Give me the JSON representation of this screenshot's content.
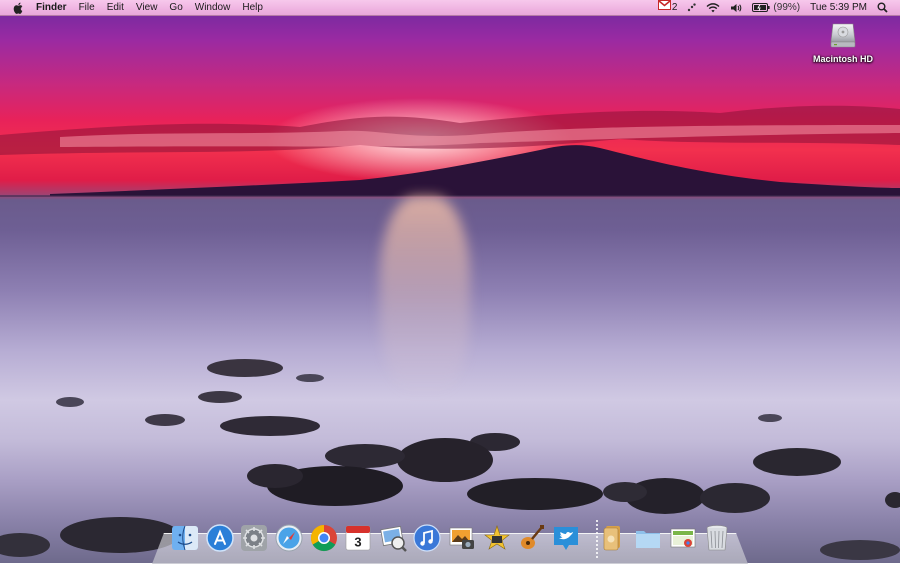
{
  "menubar": {
    "app_name": "Finder",
    "menus": [
      "File",
      "Edit",
      "View",
      "Go",
      "Window",
      "Help"
    ],
    "status": {
      "gmail_count": "2",
      "battery": "(99%)",
      "clock": "Tue 5:39 PM"
    }
  },
  "desktop": {
    "icons": [
      {
        "label": "Macintosh HD",
        "icon": "hard-drive-icon"
      }
    ]
  },
  "dock": {
    "apps": [
      "finder-icon",
      "app-store-icon",
      "system-preferences-icon",
      "safari-icon",
      "chrome-icon",
      "ical-icon",
      "preview-icon",
      "itunes-icon",
      "iphoto-icon",
      "imovie-icon",
      "garageband-icon",
      "twitter-icon"
    ],
    "calendar_day": "3",
    "others": [
      "applications-stack-icon",
      "documents-folder-icon",
      "downloads-stack-icon",
      "trash-icon"
    ]
  },
  "colors": {
    "menubar": "#f2b9e6",
    "sky_top": "#6a2aa0",
    "sunset": "#f2304e",
    "water": "#b6acd3"
  }
}
